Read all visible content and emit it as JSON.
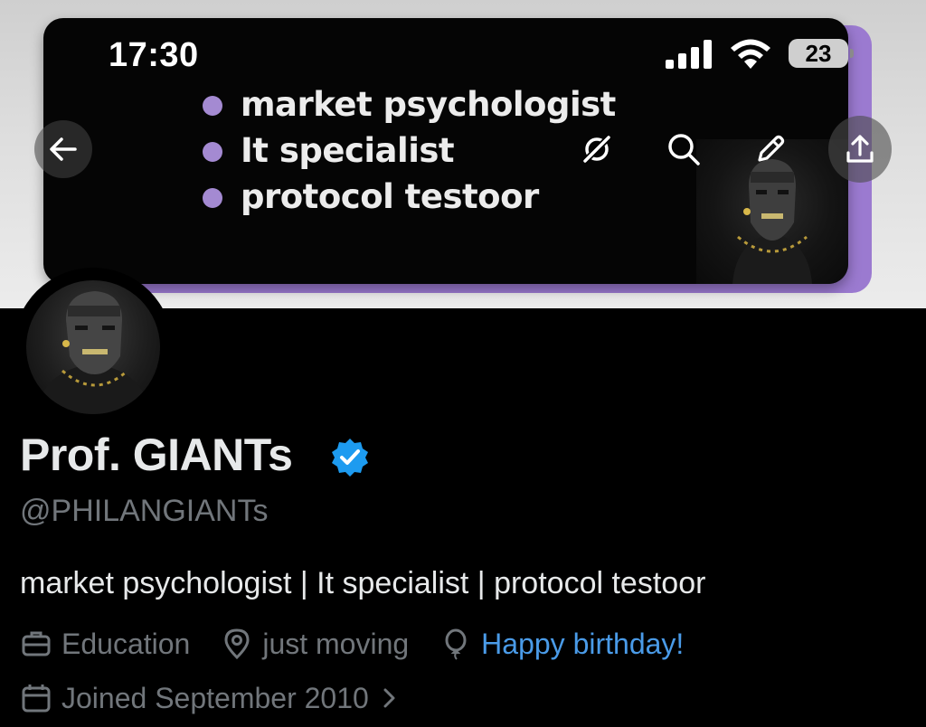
{
  "status_bar": {
    "time": "17:30",
    "battery_level": "23",
    "icons": [
      "cellular-signal-icon",
      "wifi-icon",
      "battery-icon"
    ]
  },
  "banner": {
    "lines": [
      "market psychologist",
      "It specialist",
      "protocol testoor"
    ],
    "accent_color": "#9b7ad0"
  },
  "nav": {
    "buttons": [
      "back-arrow-icon",
      "grok-icon",
      "search-icon",
      "edit-pencil-icon",
      "share-icon"
    ]
  },
  "profile": {
    "name": "Prof. GIANTs",
    "verified": true,
    "verified_color": "#1d9bf0",
    "handle": "@PHILANGIANTs",
    "bio": "market psychologist | It specialist | protocol testoor",
    "category": "Education",
    "location": "just moving",
    "birthday": "Happy birthday!",
    "joined": "Joined September 2010",
    "link_color": "#4a9be8"
  }
}
